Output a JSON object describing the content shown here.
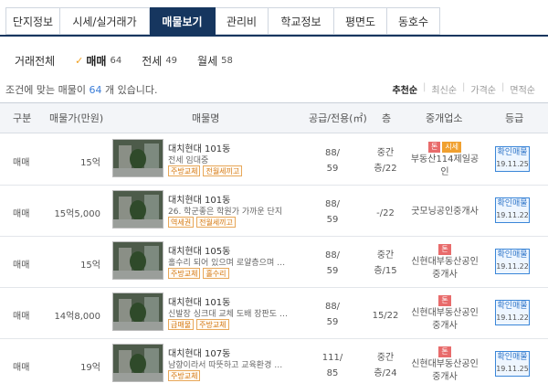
{
  "tabs": [
    {
      "label": "단지정보"
    },
    {
      "label": "시세/실거래가"
    },
    {
      "label": "매물보기"
    },
    {
      "label": "관리비"
    },
    {
      "label": "학교정보"
    },
    {
      "label": "평면도"
    },
    {
      "label": "동호수"
    }
  ],
  "active_tab": "매물보기",
  "filters": [
    {
      "label": "거래전체",
      "count": ""
    },
    {
      "label": "매매",
      "count": "64"
    },
    {
      "label": "전세",
      "count": "49"
    },
    {
      "label": "월세",
      "count": "58"
    }
  ],
  "summary": {
    "prefix": "조건에 맞는 매물이",
    "count": "64",
    "suffix": "개 있습니다."
  },
  "sort_options": [
    "추천순",
    "최신순",
    "가격순",
    "면적순"
  ],
  "table": {
    "headers": {
      "type": "구분",
      "price": "매물가(만원)",
      "name": "매물명",
      "area": "공급/전용(㎡)",
      "floor": "층",
      "agent": "중개업소",
      "grade": "등급"
    },
    "rows": [
      {
        "type": "매매",
        "price": "15억",
        "name": "대치현대 101동",
        "desc": "전세 임대중",
        "tags": [
          "주방교체",
          "전월세끼고"
        ],
        "area_top": "88/",
        "area_bottom": "59",
        "floor_top": "중간",
        "floor_bottom": "층/22",
        "badges": [
          "톤",
          "시세"
        ],
        "agent_line1": "부동산114제일공",
        "agent_line2": "인",
        "verify": "확인매물",
        "date": "19.11.25"
      },
      {
        "type": "매매",
        "price": "15억5,000",
        "name": "대치현대 101동",
        "desc": "26. 학군좋은 학원가 가까운 단지",
        "tags": [
          "역세권",
          "전월세끼고"
        ],
        "area_top": "88/",
        "area_bottom": "59",
        "floor_top": "-/22",
        "floor_bottom": "",
        "badges": [],
        "agent_line1": "굿모닝공인중개사",
        "agent_line2": "",
        "verify": "확인매물",
        "date": "19.11.22"
      },
      {
        "type": "매매",
        "price": "15억",
        "name": "대치현대 105동",
        "desc": "홀수리 되어 있으며 로얄층으며 조...",
        "tags": [
          "주방교체",
          "홀수리"
        ],
        "area_top": "88/",
        "area_bottom": "59",
        "floor_top": "중간",
        "floor_bottom": "층/15",
        "badges": [
          "톤"
        ],
        "agent_line1": "신현대부동산공인",
        "agent_line2": "중개사",
        "verify": "확인매물",
        "date": "19.11.22"
      },
      {
        "type": "매매",
        "price": "14억8,000",
        "name": "대치현대 101동",
        "desc": "신발장 싱크대 교체 도배 장판도 새...",
        "tags": [
          "급매물",
          "주방교체"
        ],
        "area_top": "88/",
        "area_bottom": "59",
        "floor_top": "15/22",
        "floor_bottom": "",
        "badges": [
          "톤"
        ],
        "agent_line1": "신현대부동산공인",
        "agent_line2": "중개사",
        "verify": "확인매물",
        "date": "19.11.22"
      },
      {
        "type": "매매",
        "price": "19억",
        "name": "대치현대 107동",
        "desc": "남향이라서 따뜻하고 교육환경 아...",
        "tags": [
          "주방교체"
        ],
        "area_top": "111/",
        "area_bottom": "85",
        "floor_top": "중간",
        "floor_bottom": "층/24",
        "badges": [
          "톤"
        ],
        "agent_line1": "신현대부동산공인",
        "agent_line2": "중개사",
        "verify": "확인매물",
        "date": "19.11.25"
      }
    ]
  },
  "colors": {
    "tab_active_bg": "#16365f",
    "check": "#f0a020",
    "count_highlight": "#3b7dd8",
    "verify_border": "#3b86d8",
    "tag_border": "#e8a85a",
    "badge_red": "#e86b6b",
    "badge_orange": "#f0a030"
  },
  "icons": {
    "filter_selected": "check-icon",
    "thumbnail": "apartment-photo"
  }
}
